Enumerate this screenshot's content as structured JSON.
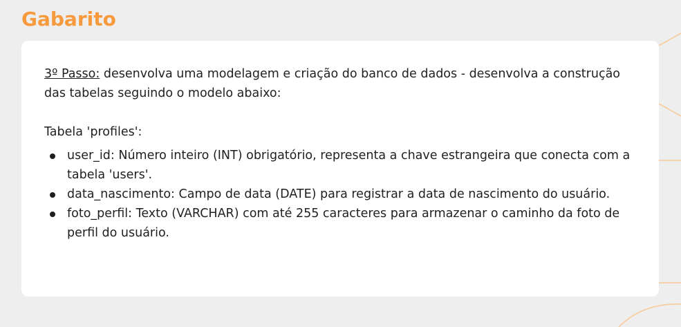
{
  "slide": {
    "title": "Gabarito",
    "accent_color": "#f79a3e",
    "background_color": "#eeeeee",
    "card_color": "#ffffff"
  },
  "step": {
    "label": "3º Passo:",
    "text": " desenvolva uma modelagem e criação do banco de dados - desenvolva a construção das tabelas seguindo o modelo abaixo:"
  },
  "table": {
    "heading": "Tabela 'profiles':",
    "fields": [
      {
        "text": "user_id: Número inteiro (INT) obrigatório, representa a chave estrangeira que conecta com a tabela 'users'."
      },
      {
        "text": "data_nascimento: Campo de data (DATE) para registrar a data de nascimento do usuário."
      },
      {
        "text": "foto_perfil: Texto (VARCHAR) com até 255 caracteres para armazenar o caminho da foto de perfil do usuário."
      }
    ]
  }
}
